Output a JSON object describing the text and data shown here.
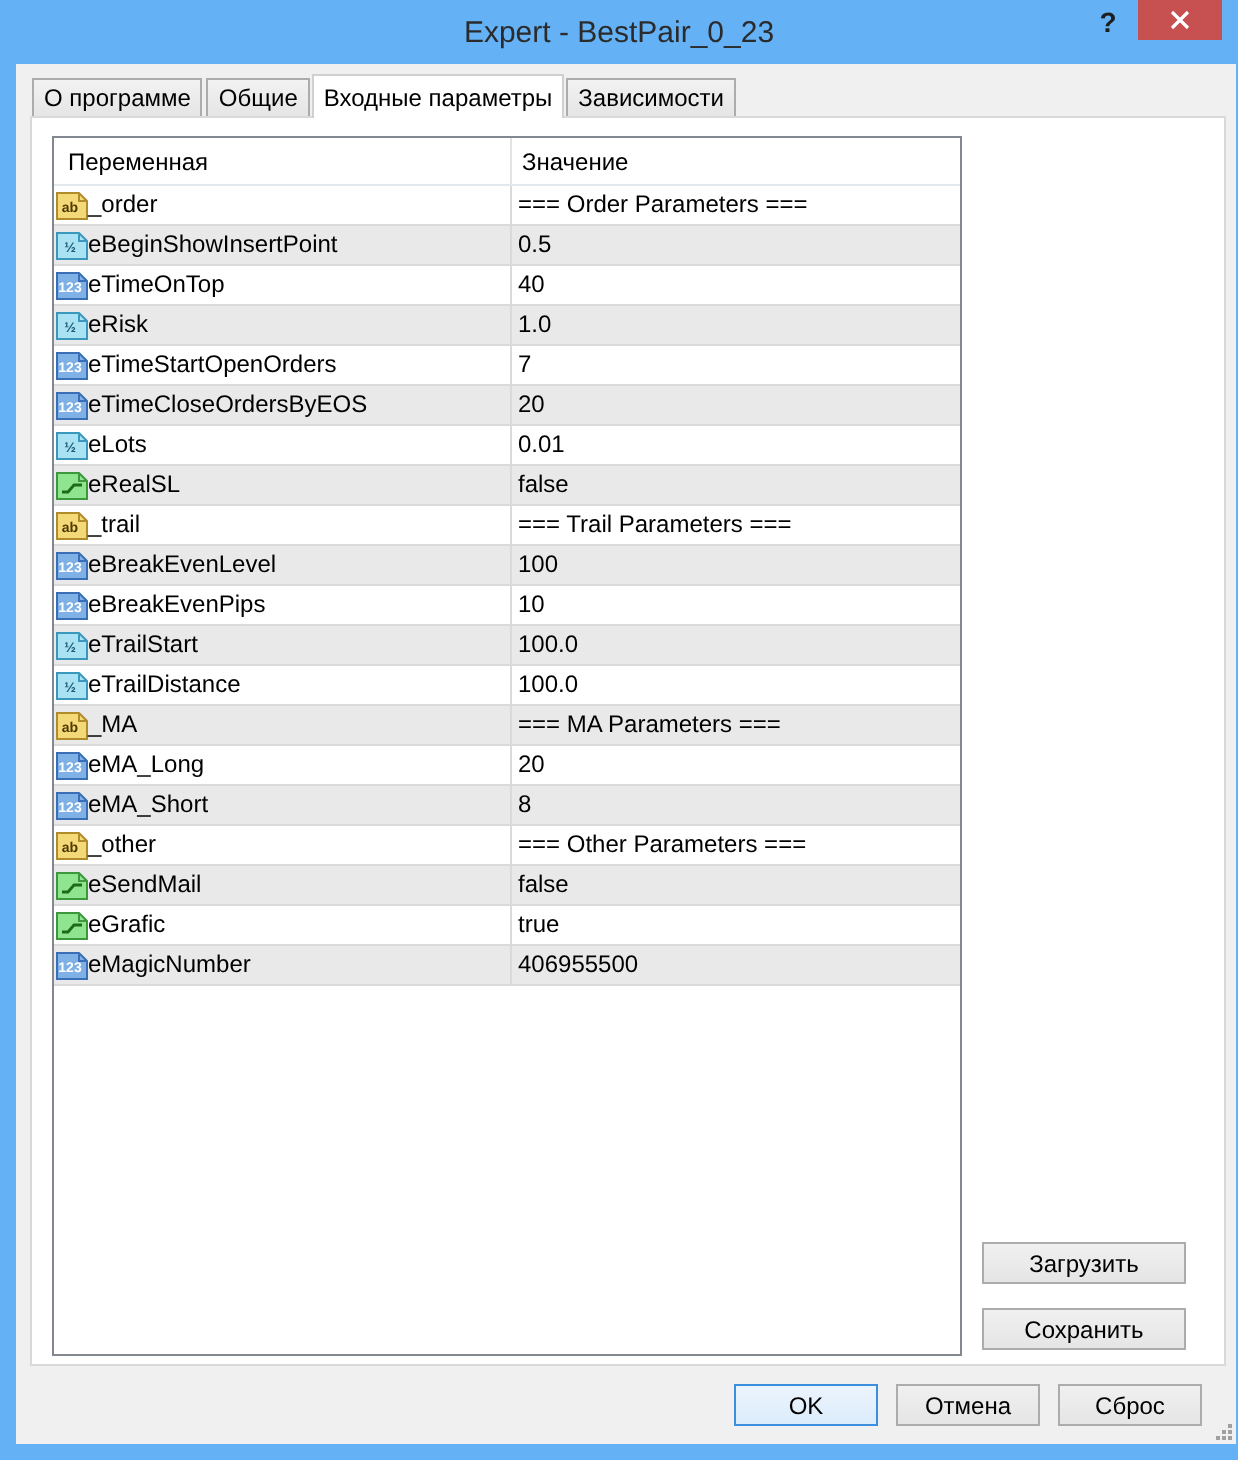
{
  "window": {
    "title": "Expert - BestPair_0_23",
    "help": "?"
  },
  "tabs": [
    {
      "label": "О программе",
      "selected": false
    },
    {
      "label": "Общие",
      "selected": false
    },
    {
      "label": "Входные параметры",
      "selected": true
    },
    {
      "label": "Зависимости",
      "selected": false
    }
  ],
  "table": {
    "columns": [
      "Переменная",
      "Значение"
    ],
    "rows": [
      {
        "kind": "string",
        "icon_text": "ab",
        "name": "_order",
        "value": "=== Order Parameters ==="
      },
      {
        "kind": "double",
        "icon_text": "½",
        "name": "eBeginShowInsertPoint",
        "value": "0.5"
      },
      {
        "kind": "int",
        "icon_text": "123",
        "name": "eTimeOnTop",
        "value": "40"
      },
      {
        "kind": "double",
        "icon_text": "½",
        "name": "eRisk",
        "value": "1.0"
      },
      {
        "kind": "int",
        "icon_text": "123",
        "name": "eTimeStartOpenOrders",
        "value": "7"
      },
      {
        "kind": "int",
        "icon_text": "123",
        "name": "eTimeCloseOrdersByEOS",
        "value": "20"
      },
      {
        "kind": "double",
        "icon_text": "½",
        "name": "eLots",
        "value": "0.01"
      },
      {
        "kind": "bool",
        "name": "eRealSL",
        "value": "false"
      },
      {
        "kind": "string",
        "icon_text": "ab",
        "name": "_trail",
        "value": "=== Trail Parameters ==="
      },
      {
        "kind": "int",
        "icon_text": "123",
        "name": "eBreakEvenLevel",
        "value": "100"
      },
      {
        "kind": "int",
        "icon_text": "123",
        "name": "eBreakEvenPips",
        "value": "10"
      },
      {
        "kind": "double",
        "icon_text": "½",
        "name": "eTrailStart",
        "value": "100.0"
      },
      {
        "kind": "double",
        "icon_text": "½",
        "name": "eTrailDistance",
        "value": "100.0"
      },
      {
        "kind": "string",
        "icon_text": "ab",
        "name": "_MA",
        "value": "=== MA Parameters ==="
      },
      {
        "kind": "int",
        "icon_text": "123",
        "name": "eMA_Long",
        "value": "20"
      },
      {
        "kind": "int",
        "icon_text": "123",
        "name": "eMA_Short",
        "value": "8"
      },
      {
        "kind": "string",
        "icon_text": "ab",
        "name": "_other",
        "value": "=== Other Parameters ==="
      },
      {
        "kind": "bool",
        "name": "eSendMail",
        "value": "false"
      },
      {
        "kind": "bool",
        "name": "eGrafic",
        "value": "true"
      },
      {
        "kind": "int",
        "icon_text": "123",
        "name": "eMagicNumber",
        "value": "406955500"
      }
    ]
  },
  "side_buttons": [
    "Загрузить",
    "Сохранить"
  ],
  "buttons": [
    {
      "label": "OK",
      "focused": true
    },
    {
      "label": "Отмена",
      "focused": false
    },
    {
      "label": "Сброс",
      "focused": false
    }
  ]
}
